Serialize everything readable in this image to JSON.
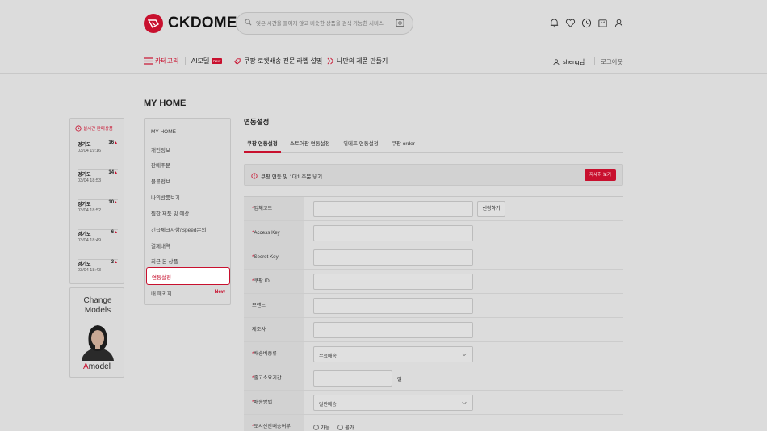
{
  "brand": {
    "name": "CKDOME"
  },
  "search": {
    "placeholder": "잊은 시간을 들이지 않고 비슷한 상품을 검색 가능한 서비스"
  },
  "nav": {
    "category": "카테고리",
    "ai_model": "AI모델",
    "new_badge": "New",
    "rocket": "쿠팡 로켓배송 전문 라벨 설명",
    "custom": "나만의 제품 만들기",
    "user": "sheng님",
    "logout": "로그아웃"
  },
  "page_title": "MY HOME",
  "realtime": {
    "title": "실시간 판매상품",
    "items": [
      {
        "region": "경기도",
        "count": "16",
        "time": "03/04 19:16"
      },
      {
        "region": "경기도",
        "count": "14",
        "time": "03/04 18:53"
      },
      {
        "region": "경기도",
        "count": "10",
        "time": "03/04 18:52"
      },
      {
        "region": "경기도",
        "count": "6",
        "time": "03/04 18:49"
      },
      {
        "region": "경기도",
        "count": "3",
        "time": "03/04 18:43"
      }
    ]
  },
  "model_card": {
    "title": "Change Models",
    "brand_a": "A",
    "brand_rest": "model"
  },
  "menu": {
    "items": [
      "MY HOME",
      "개인정보",
      "판매주문",
      "물류정보",
      "나의반품보기",
      "찜한 제품 및 예상",
      "긴급체크사항/Speed문의",
      "결제내역",
      "최근 본 상품"
    ],
    "active": "연동설정",
    "last": "내 패키지",
    "last_badge": "New"
  },
  "main": {
    "title": "연동설정",
    "tabs": [
      "쿠팡 연동설정",
      "스토어팜 연동설정",
      "위메프 연동설정",
      "쿠팡 order"
    ],
    "notice": "쿠팡 연동 및 1대1 주문 넣기",
    "notice_button": "자세히 보기"
  },
  "form": {
    "vendor_code": "업체코드",
    "apply_button": "신청하기",
    "access_key": "Access Key",
    "secret_key": "Secret Key",
    "coupang_id": "쿠팡 ID",
    "brand": "브랜드",
    "manufacturer": "제조사",
    "shipping_fee_type": "배송비종류",
    "shipping_fee_value": "무료배송",
    "lead_time": "출고소요기간",
    "lead_time_unit": "일",
    "shipping_method": "배송방법",
    "shipping_method_value": "일반배송",
    "island_delivery": "도서산간배송여부",
    "option_yes": "가능",
    "option_no": "불가"
  },
  "colors": {
    "accent": "#c8102e",
    "background": "#dcdcdc"
  }
}
